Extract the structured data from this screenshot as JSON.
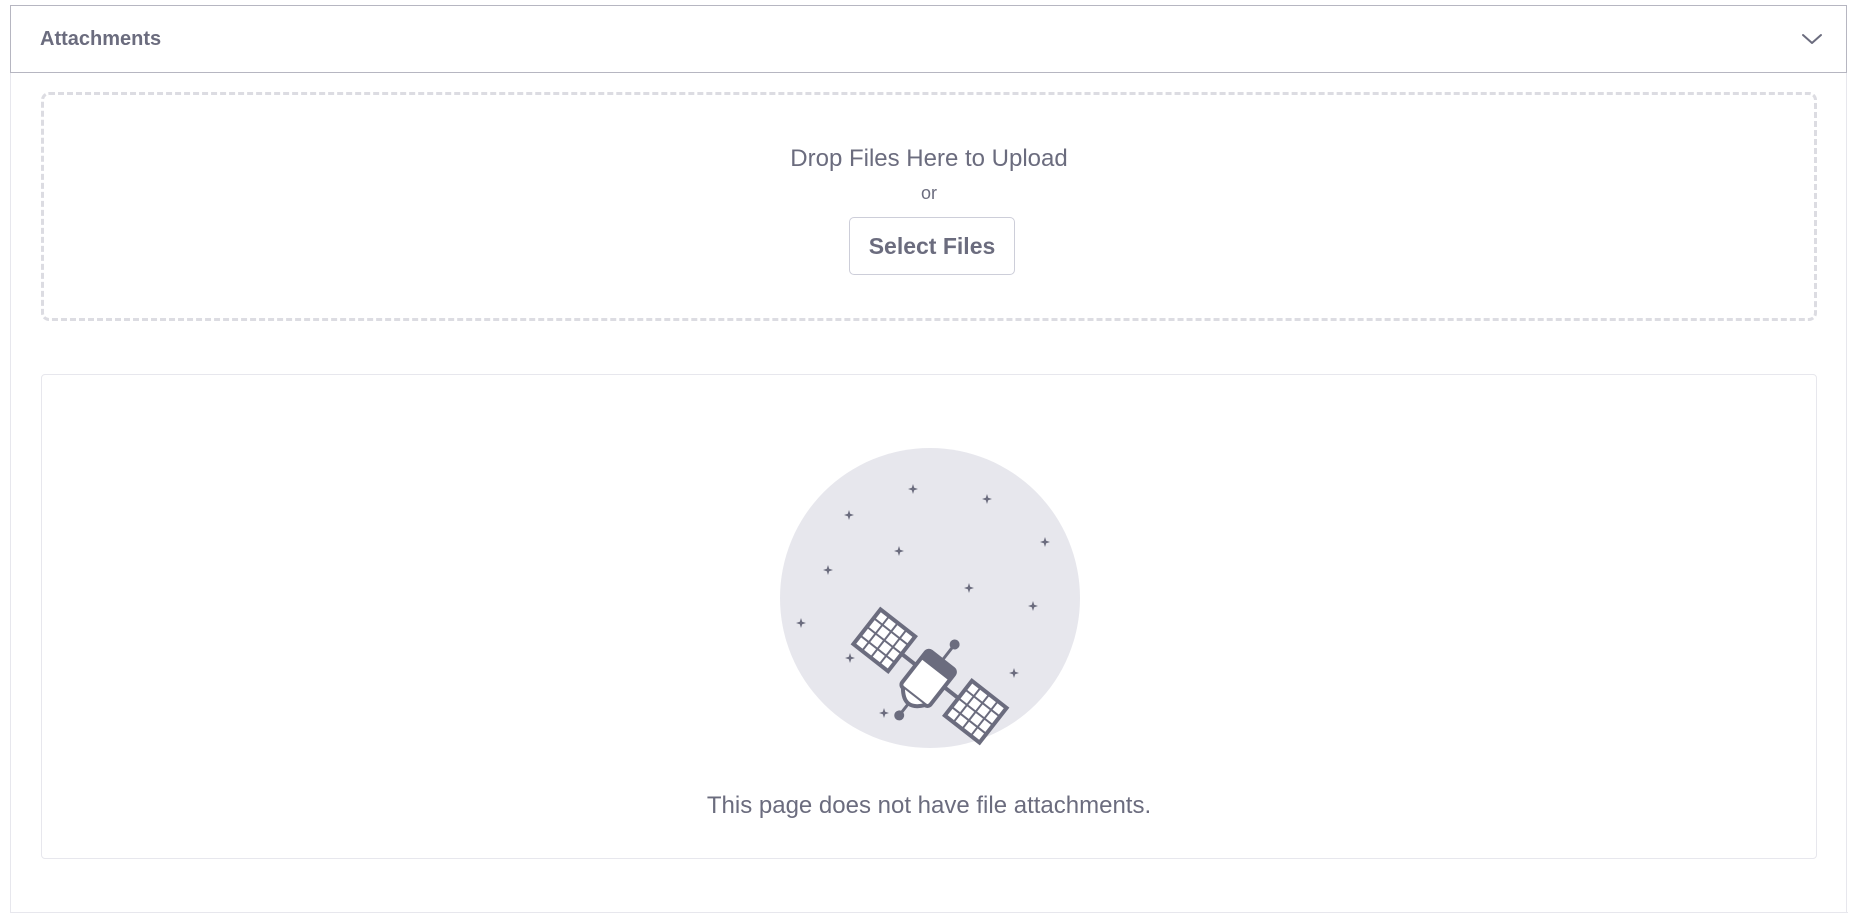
{
  "panel": {
    "title": "Attachments",
    "toggle_icon": "chevron-down-icon"
  },
  "dropzone": {
    "title": "Drop Files Here to Upload",
    "or_text": "or",
    "select_label": "Select Files"
  },
  "empty_state": {
    "message": "This page does not have file attachments.",
    "illustration": "satellite-icon"
  },
  "colors": {
    "text": "#6b6c7e",
    "border": "#e7e7ed",
    "dashed": "#dcdce2",
    "illustration_bg": "#e7e7ed",
    "illustration_fg": "#6b6c7e"
  }
}
